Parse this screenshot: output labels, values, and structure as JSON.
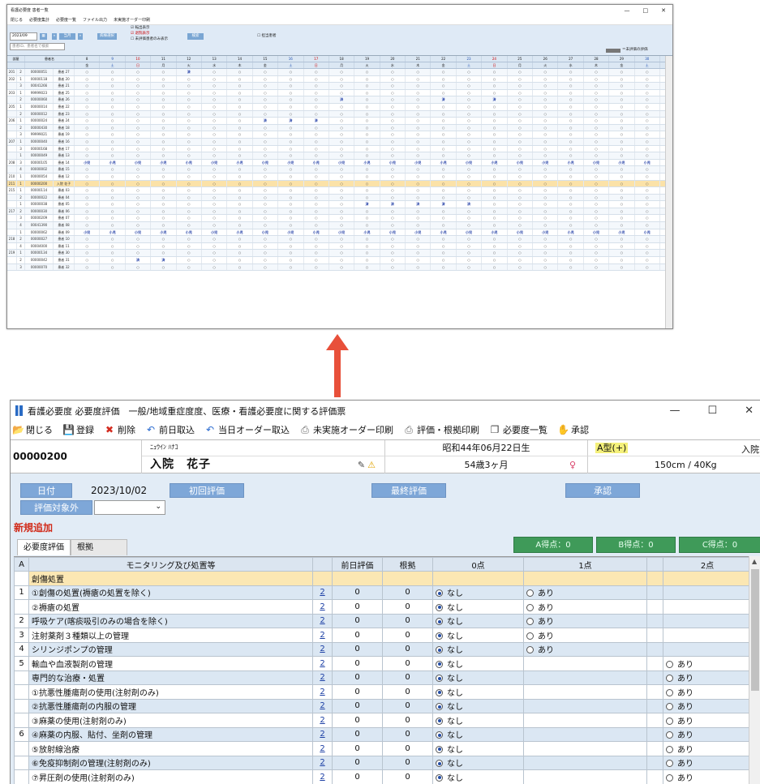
{
  "top_window": {
    "title": "看護必要度 患者一覧",
    "controls": [
      "—",
      "□",
      "✕"
    ],
    "toolbar": [
      "閉じる",
      "必要度集計",
      "必要度一覧",
      "ファイル出力",
      "未実施オーダー印刷"
    ],
    "month": "2023/09",
    "month_btn": "当月",
    "ward_btn": "病棟選択",
    "search_btn": "検索",
    "checks": [
      "転出表示",
      "退院表示",
      "未評価患者のみ表示"
    ],
    "check_right": "担当患者",
    "search_placeholder": "患者ID、患者名で検索",
    "legend_label": "＝未評価の評価",
    "head_room": "部屋",
    "head_name": "患者名",
    "days": [
      "8",
      "9",
      "10",
      "11",
      "12",
      "13",
      "14",
      "15",
      "16",
      "17",
      "18",
      "19",
      "20",
      "21",
      "22",
      "23",
      "24",
      "25",
      "26",
      "27",
      "28",
      "29",
      "30"
    ],
    "weekdays": [
      "金",
      "土",
      "日",
      "月",
      "火",
      "水",
      "木",
      "金",
      "土",
      "日",
      "月",
      "火",
      "水",
      "木",
      "金",
      "土",
      "日",
      "月",
      "火",
      "水",
      "木",
      "金",
      "土"
    ],
    "rows": [
      {
        "room": "201",
        "bed": "2",
        "id": "00000051",
        "name": "患者 27",
        "marks": {
          "4": "済"
        }
      },
      {
        "room": "202",
        "bed": "1",
        "id": "00000118",
        "name": "患者 20",
        "marks": {}
      },
      {
        "room": "",
        "bed": "3",
        "id": "00041266",
        "name": "患者 21",
        "marks": {}
      },
      {
        "room": "203",
        "bed": "1",
        "id": "99999023",
        "name": "患者 25",
        "marks": {}
      },
      {
        "room": "",
        "bed": "2",
        "id": "00000060",
        "name": "患者 26",
        "marks": {
          "10": "済",
          "14": "済",
          "16": "済"
        }
      },
      {
        "room": "205",
        "bed": "1",
        "id": "00000014",
        "name": "患者 22",
        "marks": {}
      },
      {
        "room": "",
        "bed": "2",
        "id": "00000012",
        "name": "患者 23",
        "marks": {}
      },
      {
        "room": "206",
        "bed": "1",
        "id": "00000024",
        "name": "患者 24",
        "marks": {
          "7": "済",
          "8": "済",
          "9": "済"
        }
      },
      {
        "room": "",
        "bed": "2",
        "id": "00000430",
        "name": "患者 18",
        "marks": {}
      },
      {
        "room": "",
        "bed": "3",
        "id": "99999021",
        "name": "患者 19",
        "marks": {}
      },
      {
        "room": "207",
        "bed": "1",
        "id": "00000040",
        "name": "患者 16",
        "marks": {}
      },
      {
        "room": "",
        "bed": "3",
        "id": "00000168",
        "name": "患者 17",
        "marks": {}
      },
      {
        "room": "",
        "bed": "1",
        "id": "00000049",
        "name": "患者 13",
        "marks": {}
      },
      {
        "room": "208",
        "bed": "3",
        "id": "00000105",
        "name": "患者 14",
        "marks": {
          "all": "小児"
        }
      },
      {
        "room": "",
        "bed": "4",
        "id": "00000002",
        "name": "患者 15",
        "marks": {}
      },
      {
        "room": "210",
        "bed": "1",
        "id": "00000054",
        "name": "患者 12",
        "marks": {}
      },
      {
        "room": "211",
        "bed": "1",
        "id": "00000200",
        "name": "入院 花子",
        "marks": {},
        "highlight": true
      },
      {
        "room": "215",
        "bed": "1",
        "id": "00000114",
        "name": "患者 03",
        "marks": {}
      },
      {
        "room": "",
        "bed": "2",
        "id": "00000022",
        "name": "患者 04",
        "marks": {}
      },
      {
        "room": "",
        "bed": "1",
        "id": "00000038",
        "name": "患者 05",
        "marks": {
          "11": "済",
          "12": "済",
          "13": "済",
          "14": "済",
          "15": "済"
        }
      },
      {
        "room": "217",
        "bed": "2",
        "id": "00000030",
        "name": "患者 06",
        "marks": {}
      },
      {
        "room": "",
        "bed": "3",
        "id": "00000209",
        "name": "患者 07",
        "marks": {}
      },
      {
        "room": "",
        "bed": "4",
        "id": "00041390",
        "name": "患者 08",
        "marks": {}
      },
      {
        "room": "",
        "bed": "1",
        "id": "00000062",
        "name": "患者 09",
        "marks": {
          "all": "小児"
        }
      },
      {
        "room": "218",
        "bed": "2",
        "id": "00000027",
        "name": "患者 10",
        "marks": {}
      },
      {
        "room": "",
        "bed": "4",
        "id": "00004000",
        "name": "患者 11",
        "marks": {}
      },
      {
        "room": "219",
        "bed": "1",
        "id": "00000134",
        "name": "患者 30",
        "marks": {}
      },
      {
        "room": "",
        "bed": "2",
        "id": "00000042",
        "name": "患者 31",
        "marks": {
          "2": "済",
          "3": "済"
        }
      },
      {
        "room": "",
        "bed": "3",
        "id": "00000070",
        "name": "患者 32",
        "marks": {}
      }
    ]
  },
  "main_window": {
    "title": "看護必要度 必要度評価　一般/地域重症度度、医療・看護必要度に関する評価票",
    "controls": [
      "—",
      "☐",
      "✕"
    ],
    "toolbar": [
      {
        "label": "閉じる",
        "icon": "folder-icon",
        "glyph": "📂"
      },
      {
        "label": "登録",
        "icon": "save-icon",
        "glyph": "💾"
      },
      {
        "label": "削除",
        "icon": "delete-icon",
        "glyph": "✖"
      },
      {
        "label": "前日取込",
        "icon": "undo-icon",
        "glyph": "↶"
      },
      {
        "label": "当日オーダー取込",
        "icon": "undo-icon",
        "glyph": "↶"
      },
      {
        "label": "未実施オーダー印刷",
        "icon": "printer-icon",
        "glyph": "⎙"
      },
      {
        "label": "評価・根拠印刷",
        "icon": "printer-icon",
        "glyph": "⎙"
      },
      {
        "label": "必要度一覧",
        "icon": "copy-icon",
        "glyph": "❐"
      },
      {
        "label": "承認",
        "icon": "approve-icon",
        "glyph": "✋"
      }
    ],
    "patient": {
      "id": "00000200",
      "kana": "ﾆｭｳｲﾝ ﾊﾅｺ",
      "name": "入院　花子",
      "dob": "昭和44年06月22日生",
      "age": "54歳3ヶ月",
      "blood": "A型(+)",
      "body": "150cm / 40Kg",
      "status": "入院"
    },
    "form": {
      "date_btn": "日付",
      "date_value": "2023/10/02",
      "first_eval_btn": "初回評価",
      "final_eval_btn": "最終評価",
      "approve_btn": "承認",
      "exclude_btn": "評価対象外",
      "new_add": "新規追加",
      "tabs": [
        "必要度評価",
        "根拠"
      ],
      "scores": [
        "A得点：0",
        "B得点：0",
        "C得点：0"
      ]
    },
    "table": {
      "headers": [
        "A",
        "モニタリング及び処置等",
        "",
        "前日評価",
        "根拠",
        "0点",
        "1点",
        "2点"
      ],
      "rows": [
        {
          "num": "",
          "item": "創傷処置",
          "link": "",
          "prev": "",
          "basis": "",
          "p0": "",
          "p1": "",
          "p2": "",
          "sel": true
        },
        {
          "num": "1",
          "item": "①創傷の処置(褥瘡の処置を除く)",
          "link": "2",
          "prev": "0",
          "basis": "0",
          "p0": "なし",
          "p1": "あり",
          "p2": ""
        },
        {
          "num": "",
          "item": "②褥瘡の処置",
          "link": "2",
          "prev": "0",
          "basis": "0",
          "p0": "なし",
          "p1": "あり",
          "p2": ""
        },
        {
          "num": "2",
          "item": "呼吸ケア(喀痰吸引のみの場合を除く)",
          "link": "2",
          "prev": "0",
          "basis": "0",
          "p0": "なし",
          "p1": "あり",
          "p2": ""
        },
        {
          "num": "3",
          "item": "注射薬剤３種類以上の管理",
          "link": "2",
          "prev": "0",
          "basis": "0",
          "p0": "なし",
          "p1": "あり",
          "p2": ""
        },
        {
          "num": "4",
          "item": "シリンジポンプの管理",
          "link": "2",
          "prev": "0",
          "basis": "0",
          "p0": "なし",
          "p1": "あり",
          "p2": ""
        },
        {
          "num": "5",
          "item": "輸血や血液製剤の管理",
          "link": "2",
          "prev": "0",
          "basis": "0",
          "p0": "なし",
          "p1": "",
          "p2": "あり"
        },
        {
          "num": "",
          "item": "専門的な治療・処置",
          "link": "2",
          "prev": "0",
          "basis": "0",
          "p0": "なし",
          "p1": "",
          "p2": "あり"
        },
        {
          "num": "",
          "item": "①抗悪性腫瘍剤の使用(注射剤のみ)",
          "link": "2",
          "prev": "0",
          "basis": "0",
          "p0": "なし",
          "p1": "",
          "p2": "あり"
        },
        {
          "num": "",
          "item": "②抗悪性腫瘍剤の内服の管理",
          "link": "2",
          "prev": "0",
          "basis": "0",
          "p0": "なし",
          "p1": "",
          "p2": "あり"
        },
        {
          "num": "",
          "item": "③麻薬の使用(注射剤のみ)",
          "link": "2",
          "prev": "0",
          "basis": "0",
          "p0": "なし",
          "p1": "",
          "p2": "あり"
        },
        {
          "num": "6",
          "item": "④麻薬の内服、貼付、坐剤の管理",
          "link": "2",
          "prev": "0",
          "basis": "0",
          "p0": "なし",
          "p1": "",
          "p2": "あり"
        },
        {
          "num": "",
          "item": "⑤放射線治療",
          "link": "2",
          "prev": "0",
          "basis": "0",
          "p0": "なし",
          "p1": "",
          "p2": "あり"
        },
        {
          "num": "",
          "item": "⑥免疫抑制剤の管理(注射剤のみ)",
          "link": "2",
          "prev": "0",
          "basis": "0",
          "p0": "なし",
          "p1": "",
          "p2": "あり"
        },
        {
          "num": "",
          "item": "⑦昇圧剤の使用(注射剤のみ)",
          "link": "2",
          "prev": "0",
          "basis": "0",
          "p0": "なし",
          "p1": "",
          "p2": "あり"
        }
      ]
    }
  },
  "colors": {
    "arrow": "#e8503a",
    "button_blue": "#7ea7d8",
    "score_green": "#3f9a59",
    "selected_row": "#fbe7b3",
    "new_add_red": "#d12b1a"
  }
}
